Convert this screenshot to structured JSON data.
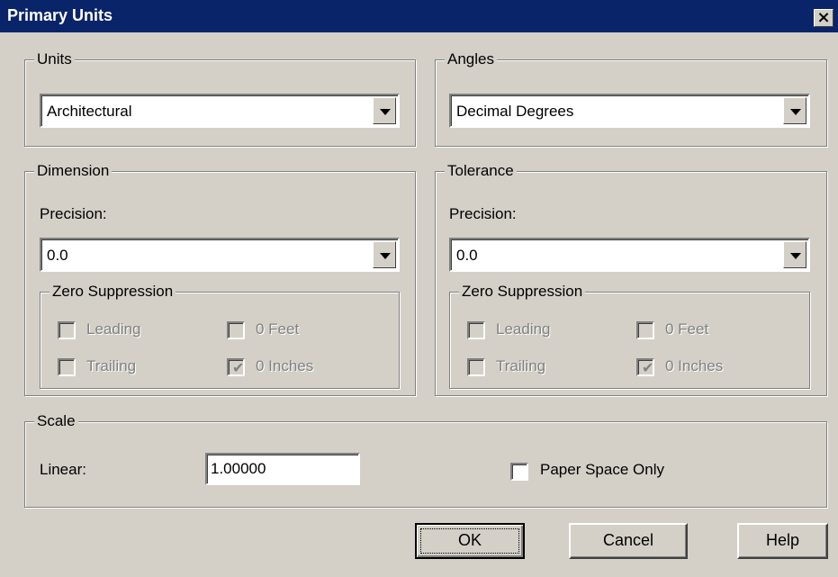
{
  "window": {
    "title": "Primary Units",
    "close_glyph": "×"
  },
  "units": {
    "label": "Units",
    "selected": "Architectural"
  },
  "angles": {
    "label": "Angles",
    "selected": "Decimal Degrees"
  },
  "dimension": {
    "label": "Dimension",
    "precision_label": "Precision:",
    "precision_value": "0.0",
    "zero_suppression": {
      "label": "Zero Suppression",
      "leading": {
        "label": "Leading",
        "checked": false
      },
      "trailing": {
        "label": "Trailing",
        "checked": false
      },
      "feet": {
        "label": "0 Feet",
        "checked": false
      },
      "inches": {
        "label": "0 Inches",
        "checked": true
      }
    }
  },
  "tolerance": {
    "label": "Tolerance",
    "precision_label": "Precision:",
    "precision_value": "0.0",
    "zero_suppression": {
      "label": "Zero Suppression",
      "leading": {
        "label": "Leading",
        "checked": false
      },
      "trailing": {
        "label": "Trailing",
        "checked": false
      },
      "feet": {
        "label": "0 Feet",
        "checked": false
      },
      "inches": {
        "label": "0 Inches",
        "checked": true
      }
    }
  },
  "scale": {
    "label": "Scale",
    "linear_label": "Linear:",
    "linear_value": "1.00000",
    "paper_space_label": "Paper Space Only",
    "paper_space_checked": false
  },
  "buttons": {
    "ok": "OK",
    "cancel": "Cancel",
    "help": "Help"
  },
  "icons": {
    "checkmark": "check-icon",
    "dropdown": "chevron-down-icon",
    "close": "close-icon"
  },
  "colors": {
    "titlebar": "#0a246a",
    "face": "#d4d0c8",
    "disabled_text": "#808080"
  }
}
